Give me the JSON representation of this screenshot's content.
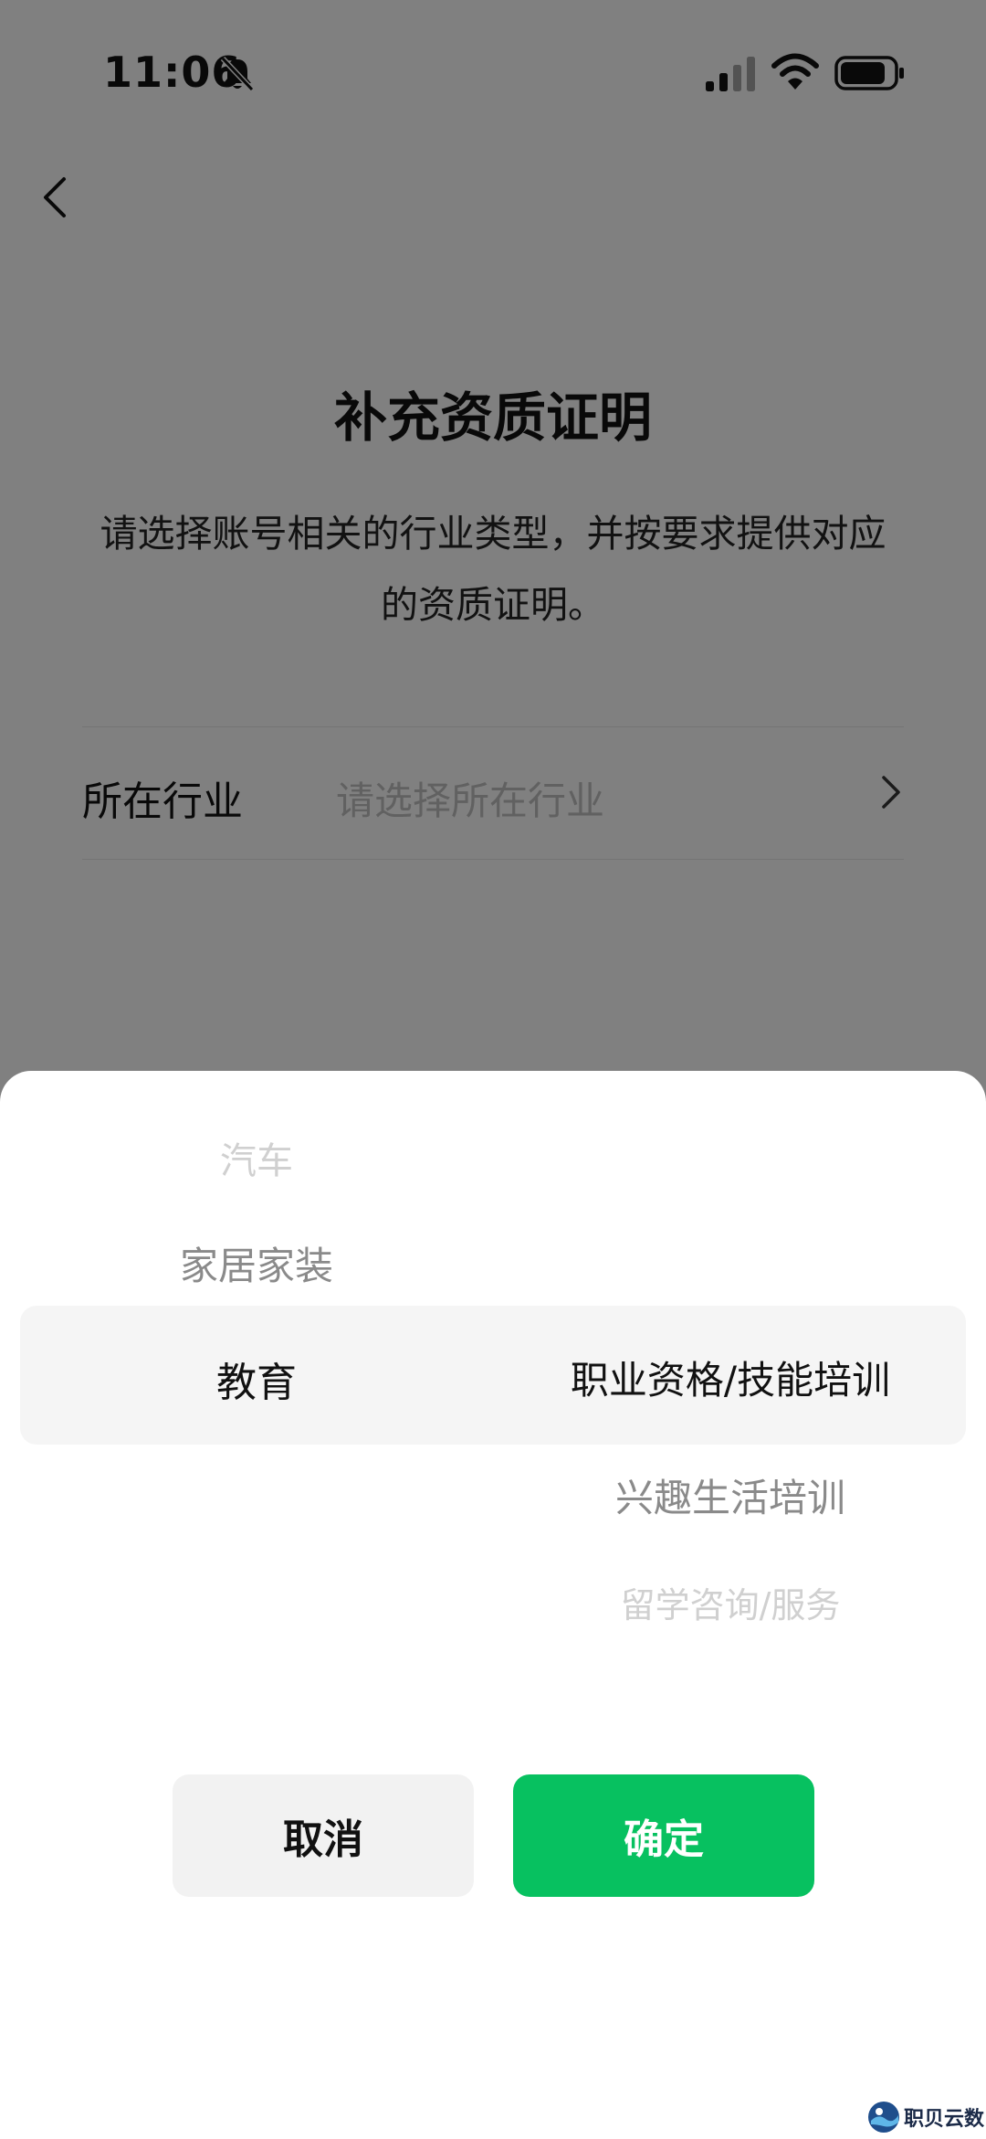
{
  "status_bar": {
    "time": "11:06",
    "icons": [
      "bell-slash-icon",
      "signal-icon",
      "wifi-icon",
      "battery-icon"
    ]
  },
  "header": {
    "back_icon": "chevron-left-icon"
  },
  "main": {
    "title": "补充资质证明",
    "description": "请选择账号相关的行业类型，并按要求提供对应的资质证明。",
    "industry_field": {
      "label": "所在行业",
      "placeholder": "请选择所在行业",
      "icon": "chevron-right-icon"
    }
  },
  "picker": {
    "left_column": [
      "汽车",
      "家居家装",
      "教育"
    ],
    "left_selected": "教育",
    "right_column": [
      "职业资格/技能培训",
      "兴趣生活培训",
      "留学咨询/服务"
    ],
    "right_selected": "职业资格/技能培训"
  },
  "actions": {
    "cancel_label": "取消",
    "confirm_label": "确定"
  },
  "colors": {
    "accent": "#07c160",
    "page_bg": "#ededed",
    "sheet_bg": "#ffffff",
    "selected_row_bg": "#f5f5f5"
  },
  "watermark": {
    "text": "职贝云数"
  }
}
